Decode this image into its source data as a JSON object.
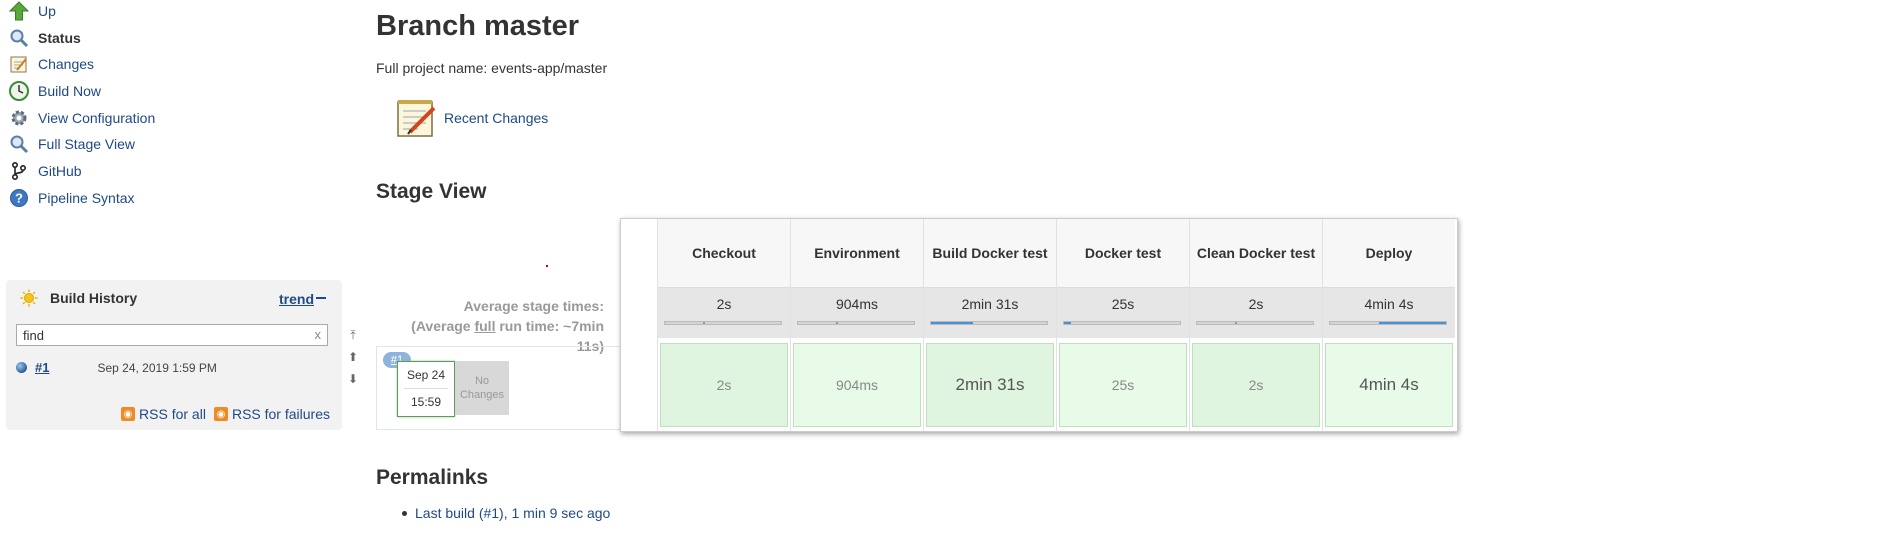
{
  "sidebar": {
    "tasks": [
      {
        "label": "Up",
        "icon": "up-arrow-icon"
      },
      {
        "label": "Status",
        "icon": "magnifier-icon"
      },
      {
        "label": "Changes",
        "icon": "notepad-icon"
      },
      {
        "label": "Build Now",
        "icon": "clock-icon"
      },
      {
        "label": "View Configuration",
        "icon": "gear-icon"
      },
      {
        "label": "Full Stage View",
        "icon": "magnifier-icon"
      },
      {
        "label": "GitHub",
        "icon": "git-branch-icon"
      },
      {
        "label": "Pipeline Syntax",
        "icon": "help-icon"
      }
    ]
  },
  "build_history": {
    "title": "Build History",
    "trend_label": "trend",
    "search_value": "find",
    "clear_label": "x",
    "builds": [
      {
        "number": "#1",
        "date": "Sep 24, 2019 1:59 PM"
      }
    ],
    "rss_all": "RSS for all",
    "rss_failures": "RSS for failures"
  },
  "main": {
    "title": "Branch master",
    "full_project_name": "Full project name: events-app/master",
    "recent_changes": "Recent Changes",
    "stage_view_title": "Stage View",
    "permalinks_title": "Permalinks",
    "permalink": "Last build (#1), 1 min 9 sec ago"
  },
  "stage_view": {
    "average_line1": "Average stage times:",
    "average_line2_pre": "(Average ",
    "average_line2_u": "full",
    "average_line2_post": " run time: ~7min",
    "average_line3": "11s)",
    "build": {
      "badge": "#1",
      "date": "Sep 24",
      "time": "15:59",
      "changes": "No Changes"
    },
    "stages": [
      {
        "name": "Checkout",
        "avg": "2s",
        "cell": "2s",
        "bar_fraction": 0.01
      },
      {
        "name": "Environment",
        "avg": "904ms",
        "cell": "904ms",
        "bar_fraction": 0.004
      },
      {
        "name": "Build Docker test",
        "avg": "2min 31s",
        "cell": "2min 31s",
        "bar_fraction": 0.36
      },
      {
        "name": "Docker test",
        "avg": "25s",
        "cell": "25s",
        "bar_fraction": 0.06
      },
      {
        "name": "Clean Docker test",
        "avg": "2s",
        "cell": "2s",
        "bar_fraction": 0.01
      },
      {
        "name": "Deploy",
        "avg": "4min 4s",
        "cell": "4min 4s",
        "bar_fraction": 0.58
      }
    ]
  },
  "colors": {
    "link": "#204a87",
    "success_cell": "#dff5df",
    "success_cell_alt": "#e8fbe8",
    "bar_fill": "#4a90d9"
  }
}
